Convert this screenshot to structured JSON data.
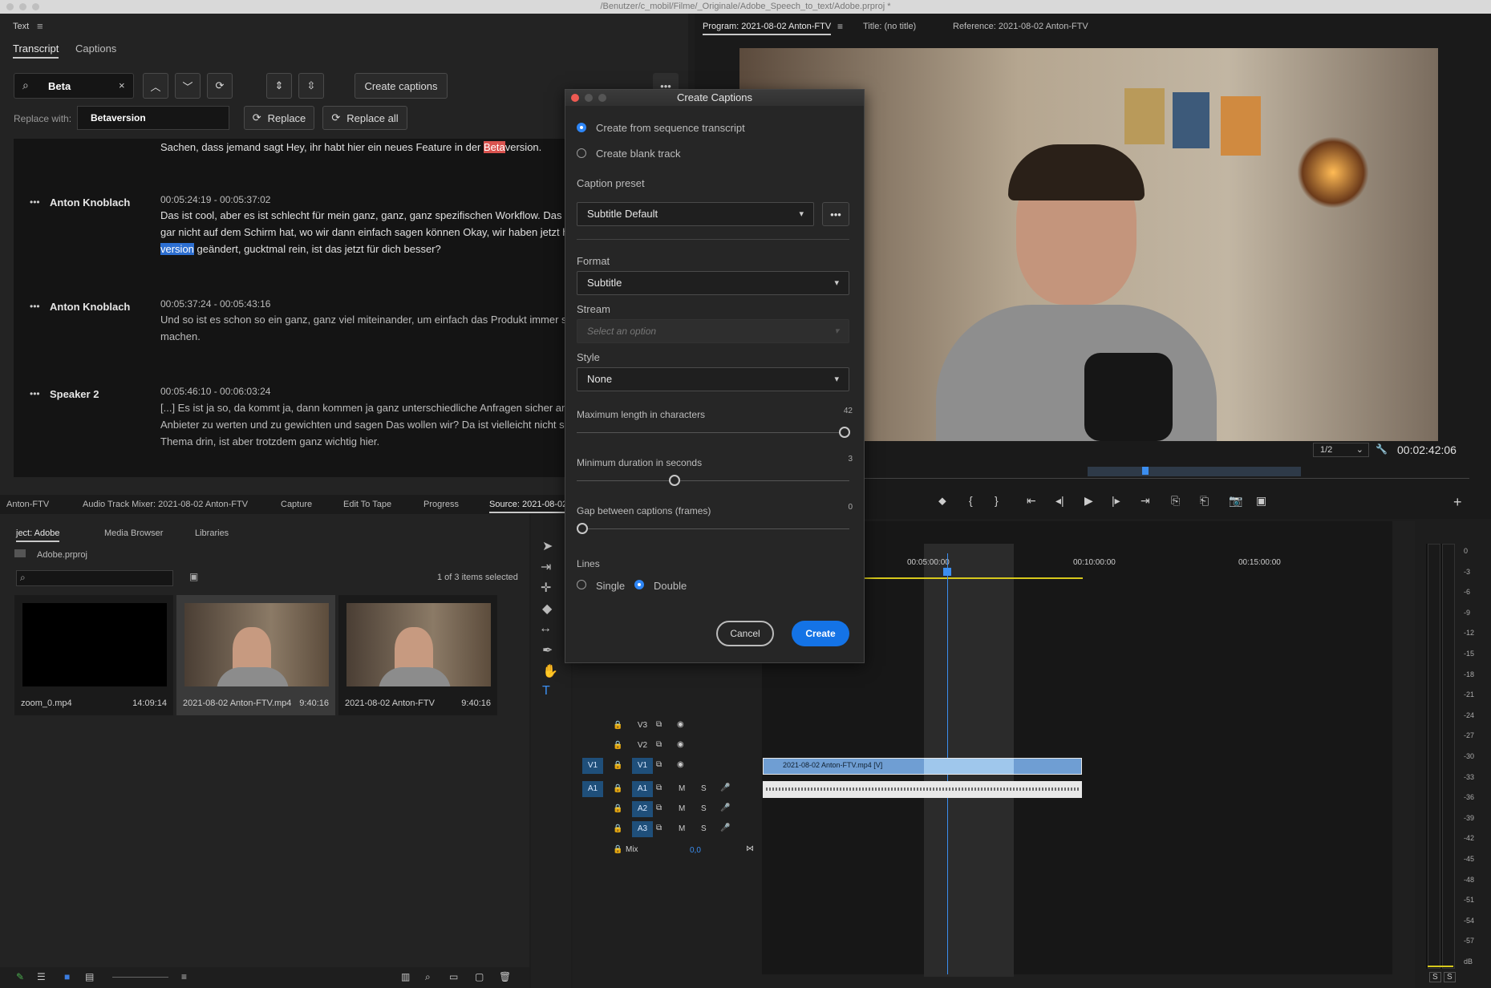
{
  "window": {
    "path": "/Benutzer/c_mobil/Filme/_Originale/Adobe_Speech_to_text/Adobe.prproj *"
  },
  "text_panel": {
    "title": "Text",
    "tabs": [
      "Transcript",
      "Captions"
    ],
    "search_value": "Beta",
    "replace_label": "Replace with:",
    "replace_value": "Betaversion",
    "create_captions": "Create captions",
    "replace_btn": "Replace",
    "replace_all_btn": "Replace all",
    "entries": [
      {
        "speaker": "",
        "timecode": "",
        "lines": [
          "Sachen, dass jemand sagt Hey, ihr habt hier ein neues Feature in der ",
          "Beta",
          "version."
        ]
      },
      {
        "speaker": "Anton Knoblach",
        "timecode": "00:05:24:19 - 00:05:37:02",
        "line1": "Das ist cool, aber es ist schlecht für mein ganz, ganz, ganz spezifischen Workflow. Das ist dann",
        "line2": "gar nicht auf dem Schirm hat, wo wir dann einfach sagen können Okay, wir haben jetzt hier",
        "line3a": "version",
        "line3b": " geändert, gucktmal rein, ist das jetzt für dich besser?"
      },
      {
        "speaker": "Anton Knoblach",
        "timecode": "00:05:37:24 - 00:05:43:16",
        "line1": "Und so ist es schon so ein ganz, ganz viel miteinander, um einfach das Produkt immer so ein",
        "line2": "machen."
      },
      {
        "speaker": "Speaker 2",
        "timecode": "00:05:46:10 - 00:06:03:24",
        "line1": "[...] Es ist ja so, da kommt ja, dann kommen ja ganz unterschiedliche Anfragen sicher an. Wie",
        "line2": "Anbieter zu werten und zu gewichten und sagen Das wollen wir? Da ist vielleicht nicht so vie",
        "line3": "Thema drin, ist aber trotzdem ganz wichtig hier."
      }
    ]
  },
  "bottom_tabs": [
    "Anton-FTV",
    "Audio Track Mixer: 2021-08-02 Anton-FTV",
    "Capture",
    "Edit To Tape",
    "Progress",
    "Source: 2021-08-02"
  ],
  "project": {
    "tabs": [
      "ject: Adobe",
      "Media Browser",
      "Libraries"
    ],
    "file": "Adobe.prproj",
    "selection": "1 of 3 items selected",
    "items": [
      {
        "name": "zoom_0.mp4",
        "duration": "14:09:14"
      },
      {
        "name": "2021-08-02 Anton-FTV.mp4",
        "duration": "9:40:16"
      },
      {
        "name": "2021-08-02 Anton-FTV",
        "duration": "9:40:16"
      }
    ]
  },
  "monitor": {
    "tabs": [
      "Program: 2021-08-02 Anton-FTV",
      "Title: (no title)",
      "Reference: 2021-08-02 Anton-FTV"
    ],
    "zoom": "1/2",
    "timecode": "00:02:42:06"
  },
  "timeline": {
    "ruler": [
      "00:05:00:00",
      "00:10:00:00",
      "00:15:00:00"
    ],
    "tracks_video": [
      "V3",
      "V2",
      "V1"
    ],
    "tracks_audio": [
      "A1",
      "A2",
      "A3"
    ],
    "src_v": "V1",
    "src_a": "A1",
    "mix_label": "Mix",
    "mix_value": "0,0",
    "clip_video": "2021-08-02 Anton-FTV.mp4 [V]",
    "m": "M",
    "s": "S"
  },
  "meter": {
    "labels": [
      "0",
      "-3",
      "-6",
      "-9",
      "-12",
      "-15",
      "-18",
      "-21",
      "-24",
      "-27",
      "-30",
      "-33",
      "-36",
      "-39",
      "-42",
      "-45",
      "-48",
      "-51",
      "-54",
      "-57",
      "dB"
    ],
    "solo": "S"
  },
  "dialog": {
    "title": "Create Captions",
    "opt1": "Create from sequence transcript",
    "opt2": "Create blank track",
    "preset_label": "Caption preset",
    "preset_value": "Subtitle Default",
    "format_label": "Format",
    "format_value": "Subtitle",
    "stream_label": "Stream",
    "stream_placeholder": "Select an option",
    "style_label": "Style",
    "style_value": "None",
    "maxlen_label": "Maximum length in characters",
    "maxlen_value": "42",
    "mindur_label": "Minimum duration in seconds",
    "mindur_value": "3",
    "gap_label": "Gap between captions (frames)",
    "gap_value": "0",
    "lines_label": "Lines",
    "single": "Single",
    "double": "Double",
    "cancel": "Cancel",
    "create": "Create"
  }
}
